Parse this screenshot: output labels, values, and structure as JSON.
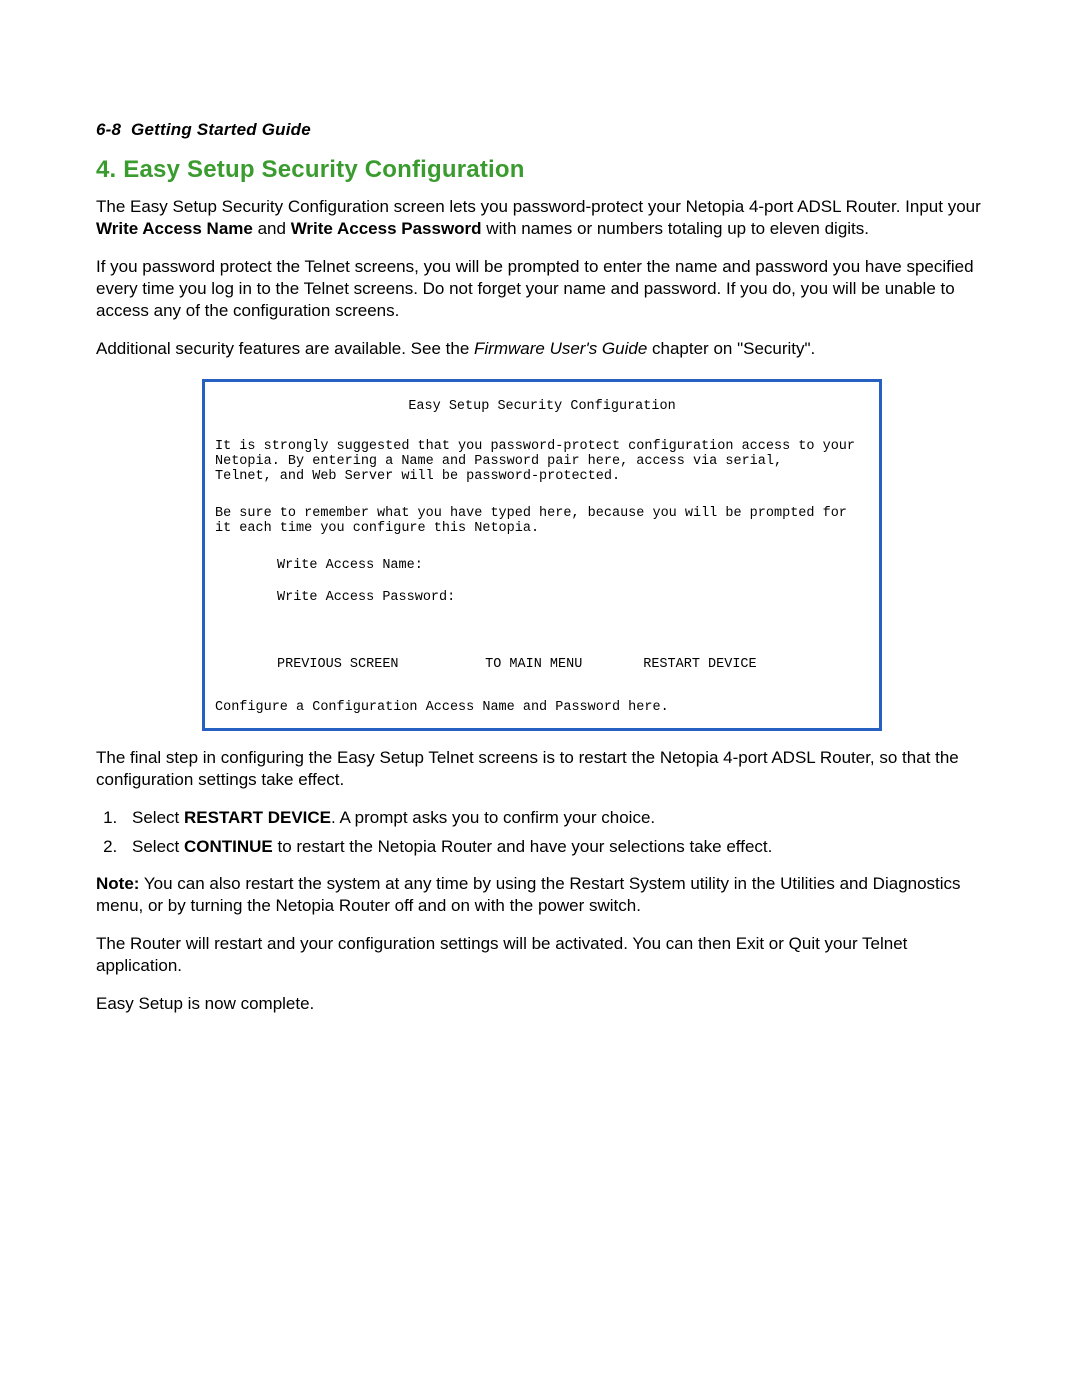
{
  "header": {
    "page_ref": "6-8",
    "guide_title": "Getting Started Guide"
  },
  "section": {
    "number": "4.",
    "title": "Easy Setup Security Configuration"
  },
  "intro": {
    "p1_a": "The Easy Setup Security Configuration screen lets you password-protect your Netopia 4-port ADSL Router. Input your ",
    "p1_b1": "Write Access Name",
    "p1_c": " and ",
    "p1_b2": "Write Access Password",
    "p1_d": " with names or numbers totaling up to eleven digits.",
    "p2": "If you password protect the Telnet screens, you will be prompted to enter the name and password you have specified every time you log in to the Telnet screens. Do not forget your name and password. If you do, you will be unable to access any of the configuration screens.",
    "p3_a": "Additional security features are available. See the ",
    "p3_b": "Firmware User's Guide",
    "p3_c": " chapter on \"Security\"."
  },
  "terminal": {
    "title": "Easy Setup Security Configuration",
    "msg1_l1": "It is strongly suggested that you password-protect configuration access to your",
    "msg1_l2": "Netopia. By entering a Name and Password pair here, access via serial,",
    "msg1_l3": "Telnet, and Web Server will be password-protected.",
    "msg2_l1": "Be sure to remember what you have typed here, because you will be prompted for",
    "msg2_l2": "it each time you configure this Netopia.",
    "field_name_label": "Write Access Name:",
    "field_pass_label": "Write Access Password:",
    "nav_prev": "PREVIOUS SCREEN",
    "nav_main": "TO MAIN MENU",
    "nav_restart": "RESTART DEVICE",
    "hint": "Configure a Configuration Access Name and Password here."
  },
  "after": {
    "p1": "The final step in configuring the Easy Setup Telnet screens is to restart the Netopia 4-port ADSL Router, so that the configuration settings take effect.",
    "step1_a": "Select ",
    "step1_b": "RESTART DEVICE",
    "step1_c": ". A prompt asks you to confirm your choice.",
    "step2_a": "Select ",
    "step2_b": "CONTINUE",
    "step2_c": " to restart the Netopia Router and have your selections take effect.",
    "note_label": "Note:",
    "note_text": " You can also restart the system at any time by using the Restart System utility in the Utilities and Diagnostics menu, or by turning the Netopia Router off and on with the power switch.",
    "p2": "The Router will restart and your configuration settings will be activated. You can then Exit or Quit your Telnet application.",
    "p3": "Easy Setup is now complete."
  }
}
